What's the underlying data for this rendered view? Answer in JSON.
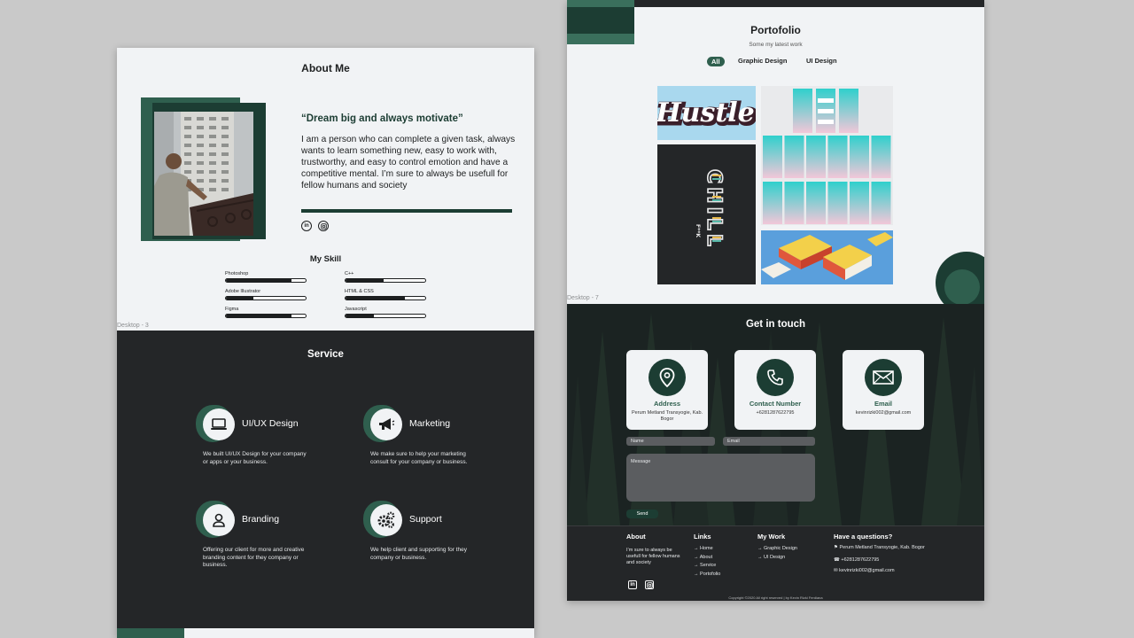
{
  "left_board": {
    "about": {
      "title": "About Me",
      "quote": "“Dream big and always motivate”",
      "bio": "I am a person who can complete a given task, always wants to learn something new, easy to work with, trustworthy, and easy to control emotion and have a competitive mental. I’m sure to always be usefull for fellow humans and society",
      "social": [
        "linkedin-icon",
        "instagram-icon"
      ]
    },
    "skills": {
      "title": "My Skill",
      "items": [
        {
          "name": "Photoshop",
          "level": 0.82
        },
        {
          "name": "C++",
          "level": 0.48
        },
        {
          "name": "Adobe Illustrator",
          "level": 0.34
        },
        {
          "name": "HTML & CSS",
          "level": 0.74
        },
        {
          "name": "Figma",
          "level": 0.82
        },
        {
          "name": "Javascript",
          "level": 0.35
        }
      ]
    },
    "frame_label": "Desktop - 3",
    "service": {
      "title": "Service",
      "items": [
        {
          "icon": "laptop-icon",
          "name": "UI/UX Design",
          "desc": "We built UI/UX Design for your company or apps or your business."
        },
        {
          "icon": "megaphone-icon",
          "name": "Marketing",
          "desc": "We make sure to help your marketing consult for your company or business."
        },
        {
          "icon": "user-icon",
          "name": "Branding",
          "desc": "Offering our client for more and creative branding content for they company or business."
        },
        {
          "icon": "gears-icon",
          "name": "Support",
          "desc": "We help client and supporting for they company or business."
        }
      ]
    }
  },
  "right_board": {
    "portfolio": {
      "title": "Portofolio",
      "subtitle": "Some my latest work",
      "filters": [
        "All",
        "Graphic Design",
        "UI Design"
      ],
      "hustle": "Hustle",
      "chill": "CHILL",
      "chill_small": "F**K"
    },
    "frame_label": "Desktop - 7",
    "contact": {
      "title": "Get in touch",
      "cards": [
        {
          "icon": "location-pin-icon",
          "title": "Address",
          "value": "Perum Metland Transyogie, Kab. Bogor"
        },
        {
          "icon": "phone-icon",
          "title": "Contact Number",
          "value": "+6281287622795"
        },
        {
          "icon": "mail-icon",
          "title": "Email",
          "value": "kevinrizki002@gmail.com"
        }
      ],
      "name_placeholder": "Name",
      "email_placeholder": "Email",
      "message_placeholder": "Message",
      "send_label": "Send"
    },
    "footer": {
      "about_head": "About",
      "about_text": "I’m sure to always be usefull for fellow humans and society",
      "links_head": "Links",
      "links": [
        "Home",
        "About",
        "Service",
        "Portofolio"
      ],
      "work_head": "My Work",
      "work": [
        "Graphic Design",
        "UI Design"
      ],
      "questions_head": "Have a questions?",
      "address": "Perum Metland Transyogie, Kab. Bogor",
      "phone": "+6281287622795",
      "email": "kevinrizki002@gmail.com",
      "copyright": "Copyright ©2020 All right reserved | by Kevin Rizki Ferdiana"
    }
  },
  "colors": {
    "page_bg": "#c9c9c9",
    "light": "#f1f3f5",
    "dark": "#242628",
    "green_dark": "#1c3d33",
    "green": "#2f5f4e"
  }
}
